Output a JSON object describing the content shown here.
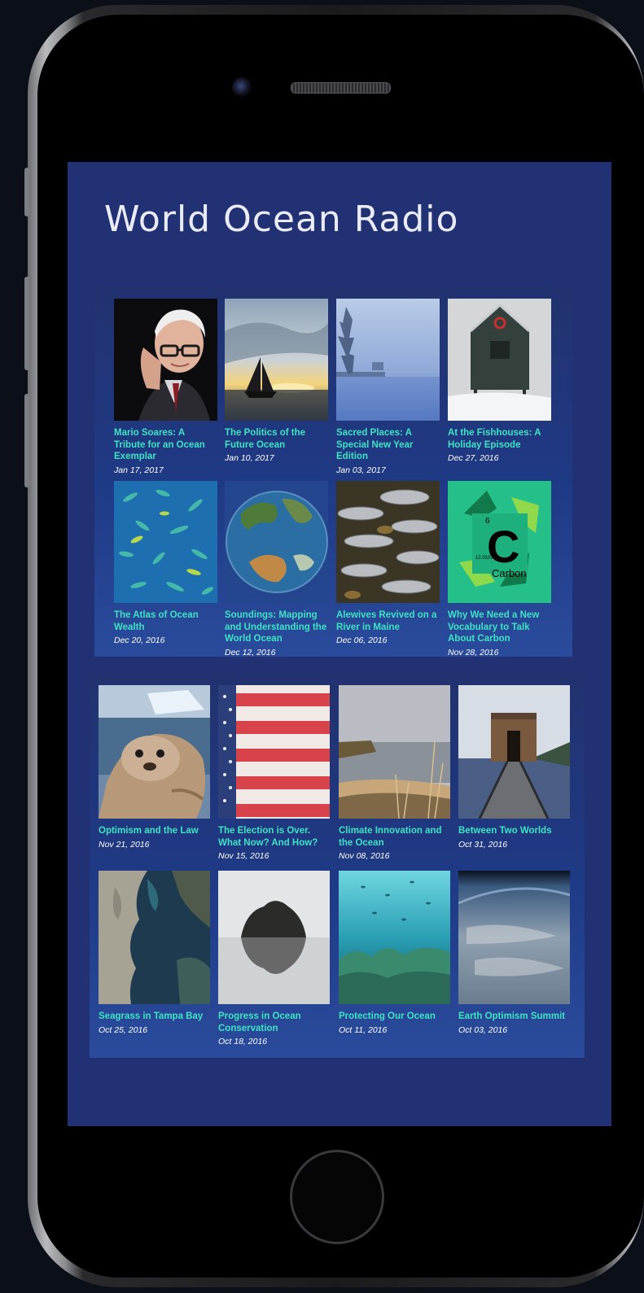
{
  "app": {
    "title": "World Ocean Radio"
  },
  "episodes": [
    {
      "title": "Mario Soares: A Tribute for an Ocean Exemplar",
      "date": "Jan 17, 2017"
    },
    {
      "title": "The Politics of the Future Ocean",
      "date": "Jan 10, 2017"
    },
    {
      "title": "Sacred Places: A Special New Year Edition",
      "date": "Jan 03, 2017"
    },
    {
      "title": "At the Fishhouses: A Holiday Episode",
      "date": "Dec 27, 2016"
    },
    {
      "title": "The Atlas of Ocean Wealth",
      "date": "Dec 20, 2016"
    },
    {
      "title": "Soundings: Mapping and Understanding the World Ocean",
      "date": "Dec 12, 2016"
    },
    {
      "title": "Alewives Revived on a River in Maine",
      "date": "Dec 06, 2016"
    },
    {
      "title": "Why We Need a New Vocabulary to Talk About Carbon",
      "date": "Nov 28, 2016"
    },
    {
      "title": "Optimism and the Law",
      "date": "Nov 21, 2016"
    },
    {
      "title": "The Election is Over. What Now? And How?",
      "date": "Nov 15, 2016"
    },
    {
      "title": "Climate Innovation and the Ocean",
      "date": "Nov 08, 2016"
    },
    {
      "title": "Between Two Worlds",
      "date": "Oct 31, 2016"
    },
    {
      "title": "Seagrass in Tampa Bay",
      "date": "Oct 25, 2016"
    },
    {
      "title": "Progress in Ocean Conservation",
      "date": "Oct 18, 2016"
    },
    {
      "title": "Protecting Our Ocean",
      "date": "Oct 11, 2016"
    },
    {
      "title": "Earth Optimism Summit",
      "date": "Oct 03, 2016"
    }
  ],
  "graphics": {
    "carbon_number": "6",
    "carbon_symbol": "C",
    "carbon_mass": "12.0107",
    "carbon_name": "Carbon"
  },
  "colors": {
    "screen_bg": "#213174",
    "title_text": "#e9ecf5",
    "episode_title": "#3fe3c4",
    "episode_date": "#ffffff"
  }
}
